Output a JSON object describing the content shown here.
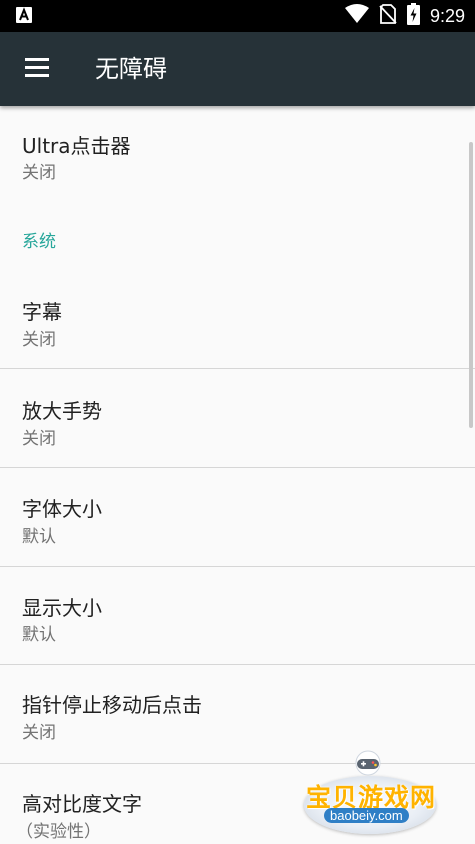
{
  "status_bar": {
    "time": "9:29",
    "icons": [
      "app-notification-icon",
      "wifi-icon",
      "no-sim-icon",
      "battery-charging-icon"
    ]
  },
  "app_bar": {
    "title": "无障碍"
  },
  "list": {
    "ultra_clicker": {
      "title": "Ultra点击器",
      "summary": "关闭"
    },
    "section_system": "系统",
    "captions": {
      "title": "字幕",
      "summary": "关闭"
    },
    "magnification": {
      "title": "放大手势",
      "summary": "关闭"
    },
    "font_size": {
      "title": "字体大小",
      "summary": "默认"
    },
    "display_size": {
      "title": "显示大小",
      "summary": "默认"
    },
    "dwell_click": {
      "title": "指针停止移动后点击",
      "summary": "关闭"
    },
    "high_contrast": {
      "title": "高对比度文字",
      "summary": "（实验性）"
    }
  },
  "watermark": {
    "title": "宝贝游戏网",
    "url": "baobeiy.com"
  },
  "colors": {
    "app_bar": "#263238",
    "accent": "#26a69a",
    "background": "#fafafa"
  }
}
